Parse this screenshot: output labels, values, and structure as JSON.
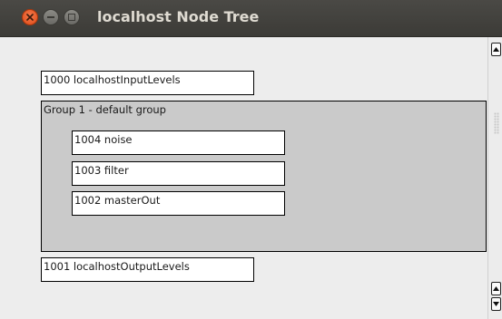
{
  "window": {
    "title": "localhost Node Tree"
  },
  "nodes": {
    "input_levels": "1000 localhostInputLevels",
    "output_levels": "1001 localhostOutputLevels"
  },
  "group": {
    "label": "Group 1 - default group",
    "children": [
      "1004 noise",
      "1003 filter",
      "1002 masterOut"
    ]
  },
  "icons": {
    "close": "close-icon",
    "minimize": "minimize-icon",
    "maximize": "maximize-icon",
    "scroll_up": "arrow-up-icon",
    "scroll_down": "arrow-down-icon"
  },
  "colors": {
    "titlebar": "#3c3b37",
    "close_button": "#e95420",
    "group_fill": "#cacaca",
    "node_fill": "#ffffff"
  }
}
